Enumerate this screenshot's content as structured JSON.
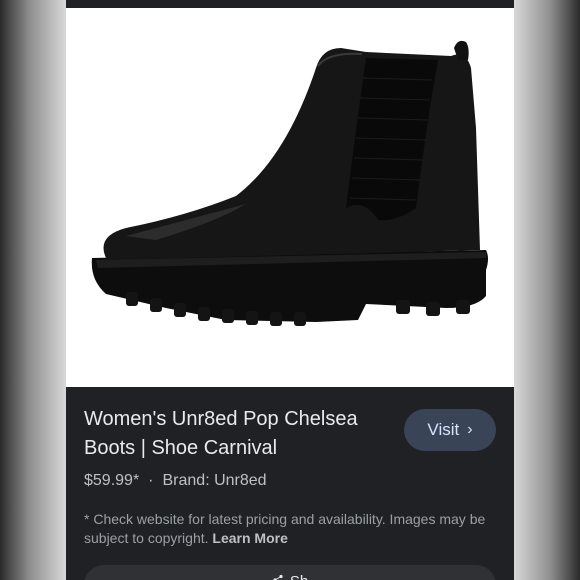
{
  "product": {
    "title": "Women's Unr8ed Pop Chelsea Boots | Shoe Carnival",
    "price": "$59.99*",
    "separator": "·",
    "brand": "Brand: Unr8ed"
  },
  "actions": {
    "visit_label": "Visit",
    "visit_chevron": "›",
    "share_label": "Sh"
  },
  "disclaimer": {
    "text": "* Check website for latest pricing and availability. Images may be subject to copyright.",
    "learn_more": "Learn More"
  },
  "icons": {
    "visit_chevron": "chevron-right-icon",
    "share": "share-icon"
  },
  "colors": {
    "panel_bg": "#202124",
    "visit_bg": "#394457",
    "visit_text": "#d6e3ff",
    "title_text": "#e8eaed"
  }
}
